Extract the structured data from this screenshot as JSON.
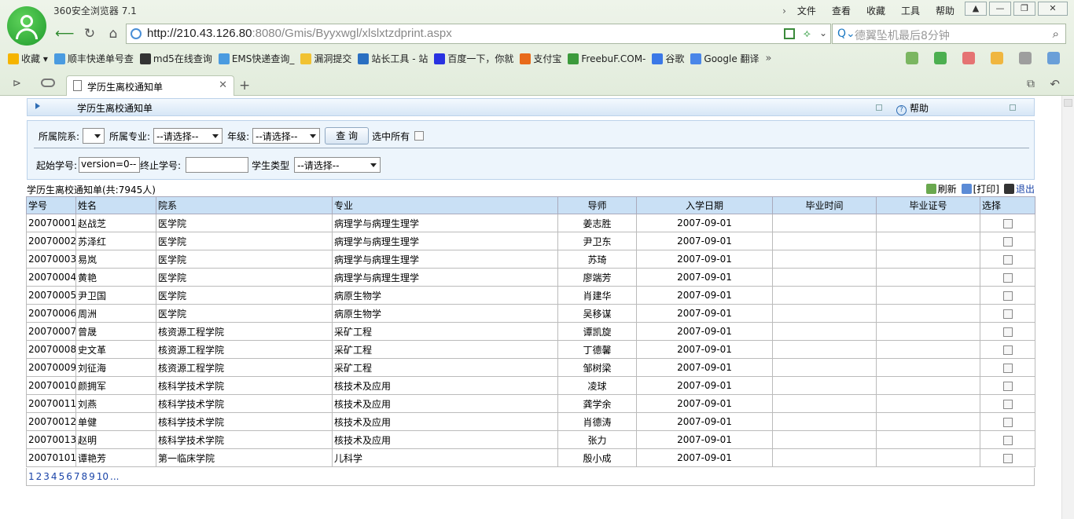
{
  "browser": {
    "title": "360安全浏览器 7.1",
    "menus": [
      "文件",
      "查看",
      "收藏",
      "工具",
      "帮助"
    ],
    "address_host": "http://210.43.126.80",
    "address_rest": ":8080/Gmis/Byyxwgl/xlslxtzdprint.aspx",
    "search_text": "德翼坠机最后8分钟",
    "bookmarks": [
      "收藏",
      "顺丰快递单号查",
      "md5在线查询",
      "EMS快递查询_",
      "漏洞提交",
      "站长工具 - 站",
      "百度一下，你就",
      "支付宝",
      "FreebuF.COM-",
      "谷歌",
      "Google 翻译"
    ],
    "tab_title": "学历生离校通知单"
  },
  "page": {
    "bar_title": "学历生离校通知单",
    "help_label": "帮助",
    "filters": {
      "dept_label": "所属院系:",
      "dept_value": "",
      "major_label": "所属专业:",
      "major_value": "--请选择--",
      "grade_label": "年级:",
      "grade_value": "--请选择--",
      "query_button": "查 询",
      "select_all_label": "选中所有",
      "start_label": "起始学号:",
      "start_value": "version=0--",
      "end_label": "终止学号:",
      "end_value": "",
      "type_label": "学生类型",
      "type_value": "--请选择--"
    },
    "count_text": "学历生离校通知单(共:7945人)",
    "actions": {
      "refresh": "刷新",
      "print": "[打印]",
      "exit": "退出"
    },
    "columns": [
      "学号",
      "姓名",
      "院系",
      "专业",
      "导师",
      "入学日期",
      "毕业时间",
      "毕业证号",
      "选择"
    ],
    "rows": [
      [
        "20070001",
        "赵战芝",
        "医学院",
        "病理学与病理生理学",
        "姜志胜",
        "2007-09-01",
        "",
        ""
      ],
      [
        "20070002",
        "苏泽红",
        "医学院",
        "病理学与病理生理学",
        "尹卫东",
        "2007-09-01",
        "",
        ""
      ],
      [
        "20070003",
        "易岚",
        "医学院",
        "病理学与病理生理学",
        "苏琦",
        "2007-09-01",
        "",
        ""
      ],
      [
        "20070004",
        "黄艳",
        "医学院",
        "病理学与病理生理学",
        "廖端芳",
        "2007-09-01",
        "",
        ""
      ],
      [
        "20070005",
        "尹卫国",
        "医学院",
        "病原生物学",
        "肖建华",
        "2007-09-01",
        "",
        ""
      ],
      [
        "20070006",
        "周洲",
        "医学院",
        "病原生物学",
        "吴移谋",
        "2007-09-01",
        "",
        ""
      ],
      [
        "20070007",
        "曾晟",
        "核资源工程学院",
        "采矿工程",
        "谭凯旋",
        "2007-09-01",
        "",
        ""
      ],
      [
        "20070008",
        "史文革",
        "核资源工程学院",
        "采矿工程",
        "丁德馨",
        "2007-09-01",
        "",
        ""
      ],
      [
        "20070009",
        "刘征海",
        "核资源工程学院",
        "采矿工程",
        "邹树梁",
        "2007-09-01",
        "",
        ""
      ],
      [
        "20070010",
        "颜拥军",
        "核科学技术学院",
        "核技术及应用",
        "凌球",
        "2007-09-01",
        "",
        ""
      ],
      [
        "20070011",
        "刘燕",
        "核科学技术学院",
        "核技术及应用",
        "龚学余",
        "2007-09-01",
        "",
        ""
      ],
      [
        "20070012",
        "单健",
        "核科学技术学院",
        "核技术及应用",
        "肖德涛",
        "2007-09-01",
        "",
        ""
      ],
      [
        "20070013",
        "赵明",
        "核科学技术学院",
        "核技术及应用",
        "张力",
        "2007-09-01",
        "",
        ""
      ],
      [
        "20070101",
        "谭艳芳",
        "第一临床学院",
        "儿科学",
        "殷小成",
        "2007-09-01",
        "",
        ""
      ]
    ],
    "pager": [
      "1",
      "2",
      "3",
      "4",
      "5",
      "6",
      "7",
      "8",
      "9",
      "10",
      "..."
    ]
  }
}
